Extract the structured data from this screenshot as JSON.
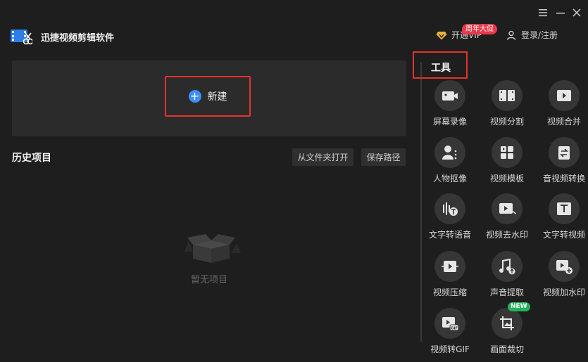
{
  "app": {
    "title": "迅捷视频剪辑软件"
  },
  "window_controls": [
    "menu-icon",
    "minimize-icon",
    "close-icon"
  ],
  "header": {
    "vip_label": "开通VIP",
    "vip_badge": "周年大促",
    "login_label": "登录/注册"
  },
  "new_project": {
    "label": "新建",
    "icon": "plus-icon"
  },
  "history": {
    "title": "历史项目",
    "open_folder_label": "从文件夹打开",
    "save_path_label": "保存路径",
    "empty_text": "暂无项目"
  },
  "tools": {
    "title": "工具",
    "items": [
      {
        "label": "屏幕录像",
        "icon": "camera-icon"
      },
      {
        "label": "视频分割",
        "icon": "film-split-icon"
      },
      {
        "label": "视频合并",
        "icon": "video-merge-icon"
      },
      {
        "label": "人物抠像",
        "icon": "person-cutout-icon"
      },
      {
        "label": "视频模板",
        "icon": "template-icon"
      },
      {
        "label": "音视频转换",
        "icon": "convert-icon"
      },
      {
        "label": "文字转语音",
        "icon": "text-to-speech-icon"
      },
      {
        "label": "视频去水印",
        "icon": "remove-watermark-icon"
      },
      {
        "label": "文字转视频",
        "icon": "text-to-video-icon"
      },
      {
        "label": "视频压缩",
        "icon": "compress-icon"
      },
      {
        "label": "声音提取",
        "icon": "audio-extract-icon"
      },
      {
        "label": "视频加水印",
        "icon": "add-watermark-icon"
      },
      {
        "label": "视频转GIF",
        "icon": "gif-icon"
      },
      {
        "label": "画面裁切",
        "icon": "crop-icon"
      }
    ],
    "new_badge": "NEW"
  },
  "colors": {
    "background": "#1e1e1e",
    "panel": "#2b2b2b",
    "accent_blue": "#3f8df5",
    "highlight_red": "#e5322d",
    "badge_green": "#23b45b",
    "vip_badge_red": "#e8394a"
  }
}
